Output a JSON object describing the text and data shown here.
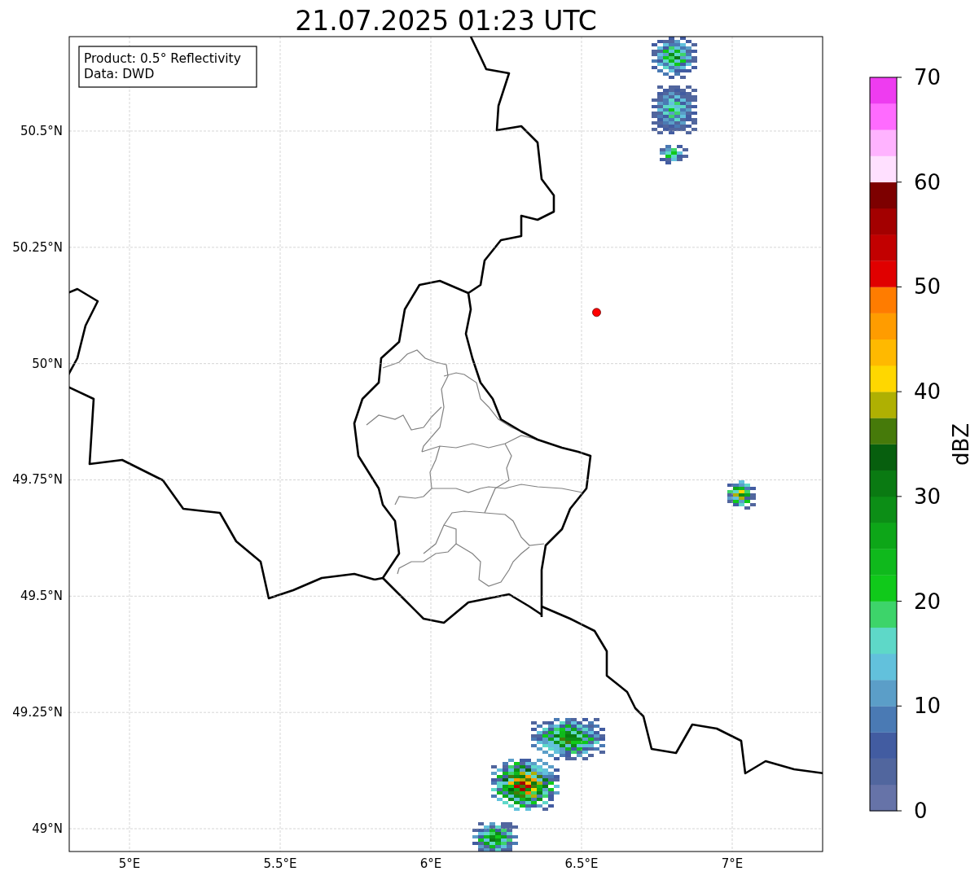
{
  "chart_data": {
    "type": "scatter",
    "grid": true,
    "title": "21.07.2025 01:23 UTC",
    "xlim": [
      4.8,
      7.3
    ],
    "ylim": [
      48.951,
      50.703
    ],
    "xticks": [
      {
        "value": 5,
        "label": "5°E"
      },
      {
        "value": 5.5,
        "label": "5.5°E"
      },
      {
        "value": 6,
        "label": "6°E"
      },
      {
        "value": 6.5,
        "label": "6.5°E"
      },
      {
        "value": 7,
        "label": "7°E"
      }
    ],
    "yticks": [
      {
        "value": 49,
        "label": "49°N"
      },
      {
        "value": 49.25,
        "label": "49.25°N"
      },
      {
        "value": 49.5,
        "label": "49.5°N"
      },
      {
        "value": 49.75,
        "label": "49.75°N"
      },
      {
        "value": 50,
        "label": "50°N"
      },
      {
        "value": 50.25,
        "label": "50.25°N"
      },
      {
        "value": 50.5,
        "label": "50.5°N"
      }
    ],
    "series": [
      {
        "color": "#ff0000",
        "x": [
          6.55
        ],
        "values": [
          50.11
        ]
      }
    ],
    "annotations": [
      "Product: 0.5° Reflectivity",
      "Data: DWD"
    ]
  },
  "colorbar": {
    "label": "dBZ",
    "ticks": [
      "70",
      "60",
      "50",
      "40",
      "30",
      "20",
      "10",
      "0"
    ],
    "segments": [
      {
        "color": "#6673a8"
      },
      {
        "color": "#51669e"
      },
      {
        "color": "#425ca1"
      },
      {
        "color": "#4a7ab4"
      },
      {
        "color": "#5b9ec8"
      },
      {
        "color": "#62c1dc"
      },
      {
        "color": "#5ed8c8"
      },
      {
        "color": "#3dd46a"
      },
      {
        "color": "#10c91a"
      },
      {
        "color": "#0fb91c"
      },
      {
        "color": "#0da618"
      },
      {
        "color": "#0c8e16"
      },
      {
        "color": "#0a7a12"
      },
      {
        "color": "#075f0e"
      },
      {
        "color": "#467a0a"
      },
      {
        "color": "#afb002"
      },
      {
        "color": "#ffd700"
      },
      {
        "color": "#ffb900"
      },
      {
        "color": "#ff9c00"
      },
      {
        "color": "#ff7c00"
      },
      {
        "color": "#e00000"
      },
      {
        "color": "#c20000"
      },
      {
        "color": "#a30000"
      },
      {
        "color": "#7d0000"
      },
      {
        "color": "#ffe0ff"
      },
      {
        "color": "#ffb3ff"
      },
      {
        "color": "#ff6bff"
      },
      {
        "color": "#ee3cf0"
      }
    ]
  }
}
